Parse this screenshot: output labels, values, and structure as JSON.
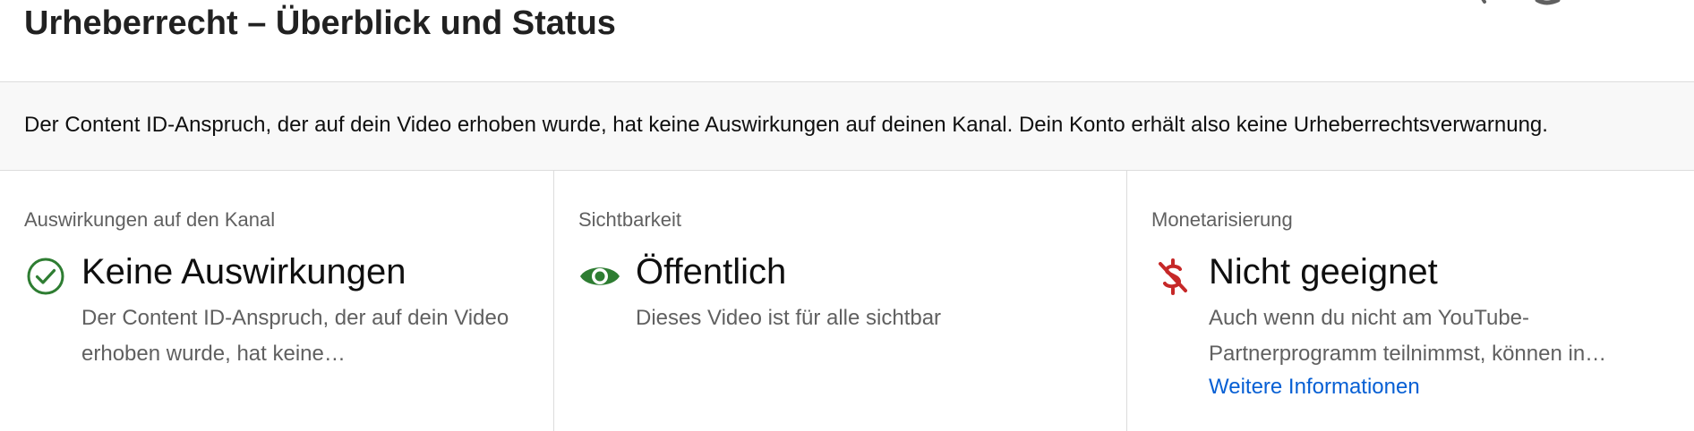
{
  "header": {
    "title": "Urheberrecht – Überblick und Status"
  },
  "banner": {
    "text": "Der Content ID-Anspruch, der auf dein Video erhoben wurde, hat keine Auswirkungen auf deinen Kanal. Dein Konto erhält also keine Urheberrechtsverwarnung."
  },
  "cards": [
    {
      "label": "Auswirkungen auf den Kanal",
      "value": "Keine Auswirkungen",
      "description": "Der Content ID-Anspruch, der auf dein Video erhoben wurde, hat keine…",
      "icon": "check-circle-icon",
      "icon_color": "#2e7d32"
    },
    {
      "label": "Sichtbarkeit",
      "value": "Öffentlich",
      "description": "Dieses Video ist für alle sichtbar",
      "icon": "eye-icon",
      "icon_color": "#2e7d32"
    },
    {
      "label": "Monetarisierung",
      "value": "Nicht geeignet",
      "description": "Auch wenn du nicht am YouTube-Partnerprogramm teilnimmst, können in…",
      "link": "Weitere Informationen",
      "icon": "no-money-icon",
      "icon_color": "#c62828"
    }
  ]
}
